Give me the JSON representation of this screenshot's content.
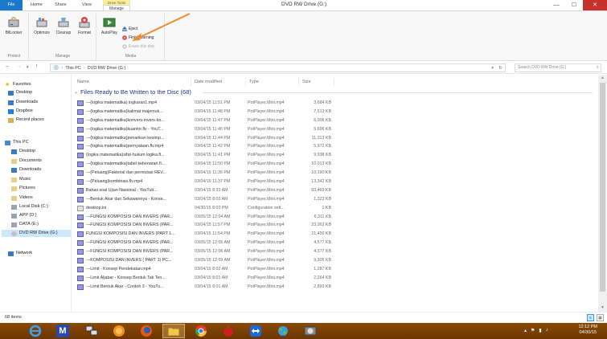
{
  "window": {
    "title": "DVD RW Drive (G:)",
    "minimize": "—",
    "maximize": "☐",
    "close": "✕"
  },
  "tabs": {
    "file": "File",
    "home": "Home",
    "share": "Share",
    "view": "View",
    "context_header": "Drive Tools",
    "manage": "Manage"
  },
  "ribbon": {
    "protect_group": "Protect",
    "manage_group": "Manage",
    "media_group": "Media",
    "bitlocker": "BitLocker",
    "optimize": "Optimize",
    "cleanup": "Cleanup",
    "format": "Format",
    "autoplay": "AutoPlay",
    "eject": "Eject",
    "finish_burning": "Finish burning",
    "erase_disc": "Erase this disc"
  },
  "address": {
    "path": [
      "This PC",
      "DVD RW Drive (G:)"
    ],
    "search_placeholder": "Search DVD RW Drive (G:)"
  },
  "nav": {
    "favorites": "Favorites",
    "desktop": "Desktop",
    "downloads": "Downloads",
    "dropbox": "Dropbox",
    "recent": "Recent places",
    "thispc": "This PC",
    "pc_desktop": "Desktop",
    "documents": "Documents",
    "pc_downloads": "Downloads",
    "music": "Music",
    "pictures": "Pictures",
    "videos": "Videos",
    "localdisk": "Local Disk (C:)",
    "app": "APP (D:)",
    "data": "DATA (E:)",
    "dvd": "DVD RW Drive (G:)",
    "network": "Network"
  },
  "columns": {
    "name": "Name",
    "date": "Date modified",
    "type": "Type",
    "size": "Size"
  },
  "group_header": "Files Ready to Be Written to the Disc (68)",
  "files": [
    {
      "name": "---(logika matematika) ingkaran1.mp4",
      "date": "03/04/15 11:51 PM",
      "type": "PotPlayer.Mini.mp4",
      "size": "3,684 KB",
      "icon": "video"
    },
    {
      "name": "---(logika matematika)kalimat majemuk...",
      "date": "03/04/15 11:48 PM",
      "type": "PotPlayer.Mini.mp4",
      "size": "7,513 KB",
      "icon": "video"
    },
    {
      "name": "---(logika matematika)konvers-invers-ko...",
      "date": "03/04/15 11:47 PM",
      "type": "PotPlayer.Mini.mp4",
      "size": "6,006 KB",
      "icon": "video"
    },
    {
      "name": "---(logika matematika)kuantor.flv - YouT...",
      "date": "03/04/15 11:46 PM",
      "type": "PotPlayer.Mini.mp4",
      "size": "5,606 KB",
      "icon": "video"
    },
    {
      "name": "---(logika matematika)penarikan kesimp...",
      "date": "03/04/15 11:44 PM",
      "type": "PotPlayer.Mini.mp4",
      "size": "11,313 KB",
      "icon": "video"
    },
    {
      "name": "---(logika matematika)pernyataan.flv.mp4",
      "date": "03/04/15 11:42 PM",
      "type": "PotPlayer.Mini.mp4",
      "size": "5,972 KB",
      "icon": "video"
    },
    {
      "name": "(logika matematika)sifat-hukum logika.fl...",
      "date": "03/04/15 11:41 PM",
      "type": "PotPlayer.Mini.mp4",
      "size": "9,938 KB",
      "icon": "video"
    },
    {
      "name": "---(logika matematika)tabel kebenaran.fl...",
      "date": "03/04/15 11:50 PM",
      "type": "PotPlayer.Mini.mp4",
      "size": "10,013 KB",
      "icon": "video"
    },
    {
      "name": "---(Peluang)Faktorial dan permutasi REV...",
      "date": "03/04/15 11:36 PM",
      "type": "PotPlayer.Mini.mp4",
      "size": "10,190 KB",
      "icon": "video"
    },
    {
      "name": "---(Peluang)kombinasi.flv.mp4",
      "date": "03/04/15 11:37 PM",
      "type": "PotPlayer.Mini.mp4",
      "size": "13,342 KB",
      "icon": "video"
    },
    {
      "name": "Bahas soal Ujian Nasional - YouTub...",
      "date": "03/04/15 8:33 AM",
      "type": "PotPlayer.Mini.mp4",
      "size": "93,469 KB",
      "icon": "video"
    },
    {
      "name": "---Bentuk Akar dan Sekawannya - Konse...",
      "date": "03/04/15 8:02 AM",
      "type": "PotPlayer.Mini.mp4",
      "size": "1,323 KB",
      "icon": "video"
    },
    {
      "name": "desktop.ini",
      "date": "04/30/15 8:03 PM",
      "type": "Configuration sett...",
      "size": "1 KB",
      "icon": "ini"
    },
    {
      "name": "---FUNGSI KOMPOSISI DAN INVERS (PAR...",
      "date": "03/05/15 12:04 AM",
      "type": "PotPlayer.Mini.mp4",
      "size": "6,311 KB",
      "icon": "video"
    },
    {
      "name": "---FUNGSI KOMPOSISI DAN INVERS (PAR...",
      "date": "03/04/15 11:57 PM",
      "type": "PotPlayer.Mini.mp4",
      "size": "23,262 KB",
      "icon": "video"
    },
    {
      "name": "FUNGSI KOMPOSISI DAN INVERS (PART 1...",
      "date": "03/04/15 11:54 PM",
      "type": "PotPlayer.Mini.mp4",
      "size": "21,436 KB",
      "icon": "video"
    },
    {
      "name": "---FUNGSI KOMPOSISI DAN INVERS (PAR...",
      "date": "03/05/15 12:05 AM",
      "type": "PotPlayer.Mini.mp4",
      "size": "4,577 KB",
      "icon": "video"
    },
    {
      "name": "---FUNGSI KOMPOSISI DAN INVERS (PAR...",
      "date": "03/05/15 12:06 AM",
      "type": "PotPlayer.Mini.mp4",
      "size": "4,377 KB",
      "icon": "video"
    },
    {
      "name": "---KOMPOSISI DAN INVERS ( PART 1) PC...",
      "date": "03/05/15 12:09 AM",
      "type": "PotPlayer.Mini.mp4",
      "size": "9,305 KB",
      "icon": "video"
    },
    {
      "name": "---Limit - Konsep Pendekatan.mp4",
      "date": "03/04/15 8:02 AM",
      "type": "PotPlayer.Mini.mp4",
      "size": "1,287 KB",
      "icon": "video"
    },
    {
      "name": "---Limit Aljabar - Konsep Bentuk Tak Ten...",
      "date": "03/04/15 8:01 AM",
      "type": "PotPlayer.Mini.mp4",
      "size": "2,264 KB",
      "icon": "video"
    },
    {
      "name": "---Limit Bentuk Akar - Contoh 3 - YouTu...",
      "date": "03/04/15 8:01 AM",
      "type": "PotPlayer.Mini.mp4",
      "size": "2,893 KB",
      "icon": "video"
    }
  ],
  "status": {
    "items": "68 items"
  },
  "taskbar": {
    "time": "12:12 PM",
    "date": "04/30/15",
    "media_app": "M"
  },
  "colors": {
    "accent": "#1979ca",
    "group_header": "#1e3287",
    "taskbar": "#7a4004",
    "annotation": "#f08a2c"
  }
}
